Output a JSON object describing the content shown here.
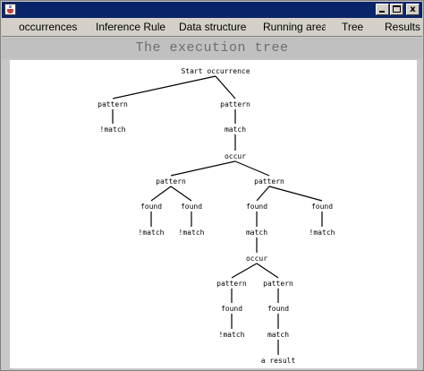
{
  "window": {
    "title": "",
    "controls": {
      "minimize": "_",
      "maximize": "□",
      "close": "x"
    }
  },
  "tabs": [
    {
      "label": "occurrences"
    },
    {
      "label": "Inference Rule"
    },
    {
      "label": "Data structure"
    },
    {
      "label": "Running area"
    },
    {
      "label": "Tree"
    },
    {
      "label": "Results"
    }
  ],
  "panel": {
    "title": "The execution tree"
  },
  "tree": {
    "nodes": [
      {
        "id": "n0",
        "label": "Start occurrence",
        "parent": null
      },
      {
        "id": "n1",
        "label": "pattern",
        "parent": "n0"
      },
      {
        "id": "n2",
        "label": "pattern",
        "parent": "n0"
      },
      {
        "id": "n3",
        "label": "!match",
        "parent": "n1"
      },
      {
        "id": "n4",
        "label": "match",
        "parent": "n2"
      },
      {
        "id": "n5",
        "label": "occur",
        "parent": "n4"
      },
      {
        "id": "n6",
        "label": "pattern",
        "parent": "n5"
      },
      {
        "id": "n7",
        "label": "pattern",
        "parent": "n5"
      },
      {
        "id": "n8",
        "label": "found",
        "parent": "n6"
      },
      {
        "id": "n9",
        "label": "found",
        "parent": "n6"
      },
      {
        "id": "n10",
        "label": "found",
        "parent": "n7"
      },
      {
        "id": "n11",
        "label": "found",
        "parent": "n7"
      },
      {
        "id": "n12",
        "label": "!match",
        "parent": "n8"
      },
      {
        "id": "n13",
        "label": "!match",
        "parent": "n9"
      },
      {
        "id": "n14",
        "label": "match",
        "parent": "n10"
      },
      {
        "id": "n15",
        "label": "!match",
        "parent": "n11"
      },
      {
        "id": "n16",
        "label": "occur",
        "parent": "n14"
      },
      {
        "id": "n17",
        "label": "pattern",
        "parent": "n16"
      },
      {
        "id": "n18",
        "label": "pattern",
        "parent": "n16"
      },
      {
        "id": "n19",
        "label": "found",
        "parent": "n17"
      },
      {
        "id": "n20",
        "label": "found",
        "parent": "n18"
      },
      {
        "id": "n21",
        "label": "!match",
        "parent": "n19"
      },
      {
        "id": "n22",
        "label": "match",
        "parent": "n20"
      },
      {
        "id": "n23",
        "label": "a result",
        "parent": "n22"
      }
    ]
  }
}
